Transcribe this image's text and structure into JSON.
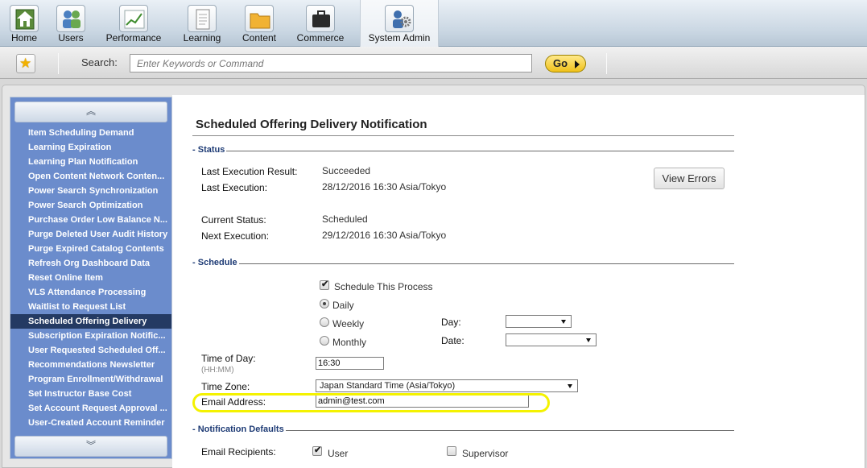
{
  "nav": {
    "tabs": [
      {
        "label": "Home",
        "icon": "home-icon"
      },
      {
        "label": "Users",
        "icon": "users-icon"
      },
      {
        "label": "Performance",
        "icon": "performance-chart-icon"
      },
      {
        "label": "Learning",
        "icon": "learning-document-icon"
      },
      {
        "label": "Content",
        "icon": "content-folder-icon"
      },
      {
        "label": "Commerce",
        "icon": "commerce-briefcase-icon"
      },
      {
        "label": "System Admin",
        "icon": "system-admin-gear-icon"
      }
    ],
    "active": "System Admin"
  },
  "search": {
    "label": "Search:",
    "placeholder": "Enter Keywords or Command",
    "go_label": "Go"
  },
  "sidebar": {
    "items": [
      {
        "label": "Item Scheduling Demand"
      },
      {
        "label": "Learning Expiration"
      },
      {
        "label": "Learning Plan Notification"
      },
      {
        "label": "Open Content Network Conten..."
      },
      {
        "label": "Power Search Synchronization"
      },
      {
        "label": "Power Search Optimization"
      },
      {
        "label": "Purchase Order Low Balance N..."
      },
      {
        "label": "Purge Deleted User Audit History"
      },
      {
        "label": "Purge Expired Catalog Contents"
      },
      {
        "label": "Refresh Org Dashboard Data"
      },
      {
        "label": "Reset Online Item"
      },
      {
        "label": "VLS Attendance Processing"
      },
      {
        "label": "Waitlist to Request List"
      },
      {
        "label": "Scheduled Offering Delivery"
      },
      {
        "label": "Subscription Expiration Notific..."
      },
      {
        "label": "User Requested Scheduled Off..."
      },
      {
        "label": "Recommendations Newsletter"
      },
      {
        "label": "Program Enrollment/Withdrawal"
      },
      {
        "label": "Set Instructor Base Cost"
      },
      {
        "label": "Set Account Request Approval ..."
      },
      {
        "label": "User-Created Account Reminder"
      }
    ],
    "active_index": 13
  },
  "main": {
    "title": "Scheduled Offering Delivery Notification",
    "status": {
      "section_label": "Status",
      "last_result_label": "Last Execution Result:",
      "last_result_value": "Succeeded",
      "last_execution_label": "Last Execution:",
      "last_execution_value": "28/12/2016 16:30 Asia/Tokyo",
      "view_errors_label": "View Errors",
      "current_status_label": "Current Status:",
      "current_status_value": "Scheduled",
      "next_execution_label": "Next Execution:",
      "next_execution_value": "29/12/2016 16:30 Asia/Tokyo"
    },
    "schedule": {
      "section_label": "Schedule",
      "schedule_process_label": "Schedule This Process",
      "schedule_process_checked": true,
      "frequency_options": [
        "Daily",
        "Weekly",
        "Monthly"
      ],
      "frequency_selected": "Daily",
      "day_label": "Day:",
      "day_value": "",
      "date_label": "Date:",
      "date_value": "",
      "time_label": "Time of Day:",
      "time_hint": "(HH:MM)",
      "time_value": "16:30",
      "timezone_label": "Time Zone:",
      "timezone_value": "Japan Standard Time (Asia/Tokyo)",
      "email_label": "Email Address:",
      "email_value": "admin@test.com"
    },
    "notification": {
      "section_label": "Notification Defaults",
      "recipients_label": "Email Recipients:",
      "user_label": "User",
      "user_checked": true,
      "supervisor_label": "Supervisor",
      "supervisor_checked": false
    }
  },
  "colors": {
    "sidebar_bg": "#6b8ccc",
    "sidebar_active": "#243a63",
    "section_label": "#1e3b75",
    "highlight": "#f4f200",
    "go_button": "#f0c11a"
  }
}
